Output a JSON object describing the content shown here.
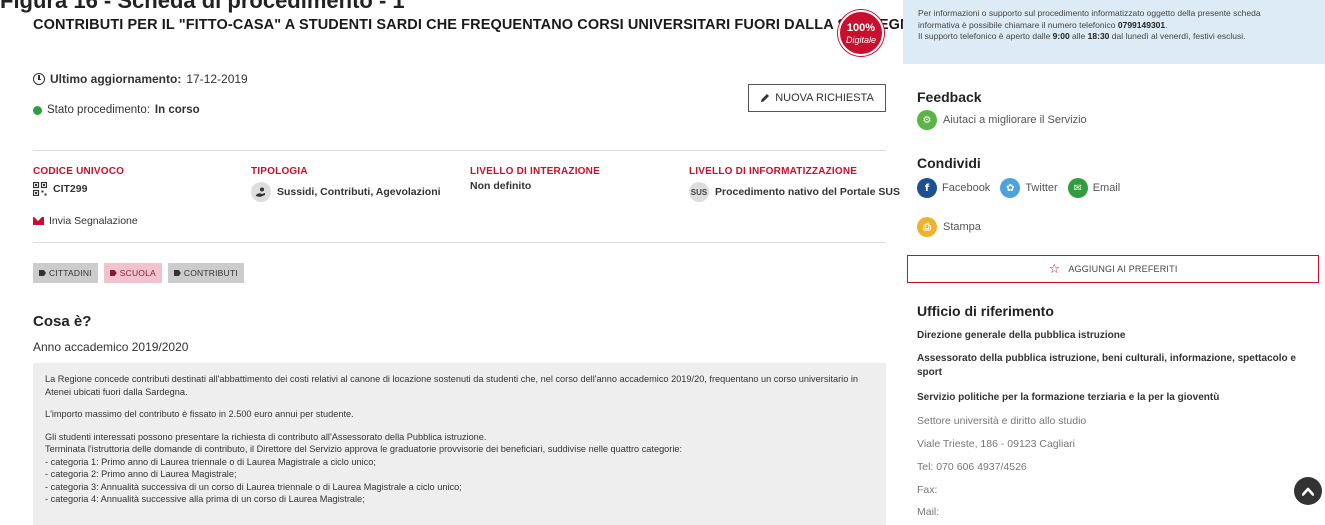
{
  "page_caption": "Figura 16 - Scheda di procedimento - 1",
  "title": "CONTRIBUTI PER IL \"FITTO-CASA\" A STUDENTI SARDI CHE FREQUENTANO CORSI UNIVERSITARI FUORI DALLA SARDEGNA",
  "digital_badge": {
    "percent": "100%",
    "label": "Digitale"
  },
  "updated": {
    "label": "Ultimo aggiornamento:",
    "value": "17-12-2019"
  },
  "status": {
    "label": "Stato procedimento:",
    "value": "In corso"
  },
  "new_request_label": "NUOVA RICHIESTA",
  "meta": {
    "codice": {
      "label": "CODICE UNIVOCO",
      "value": "CIT299"
    },
    "tipologia": {
      "label": "TIPOLOGIA",
      "value": "Sussidi, Contributi, Agevolazioni"
    },
    "livello_interazione": {
      "label": "LIVELLO DI INTERAZIONE",
      "value": "Non definito"
    },
    "livello_informatizzazione": {
      "label": "LIVELLO DI INFORMATIZZAZIONE",
      "badge": "SUS",
      "value": "Procedimento nativo del Portale SUS"
    }
  },
  "report_label": "Invia Segnalazione",
  "tags": [
    "CITTADINI",
    "SCUOLA",
    "CONTRIBUTI"
  ],
  "what_is": {
    "title": "Cosa è?",
    "year": "Anno accademico 2019/2020",
    "p1": "La Regione concede contributi destinati all'abbattimento dei costi relativi al canone di locazione sostenuti da studenti che, nel corso dell'anno accademico 2019/20, frequentano un corso universitario in Atenei ubicati fuori dalla Sardegna.",
    "p2": "L'importo massimo del contributo è fissato in 2.500 euro annui per studente.",
    "p3a": "Gli studenti interessati possono presentare la richiesta di contributo all'Assessorato della Pubblica istruzione.",
    "p3b": "Terminata l'istruttoria delle domande di contributo, il Direttore del Servizio approva le graduatorie provvisorie dei beneficiari, suddivise nelle quattro categorie:",
    "categories": [
      "- categoria 1: Primo anno di Laurea triennale o di Laurea Magistrale a ciclo unico;",
      "- categoria 2: Primo anno di Laurea Magistrale;",
      "- categoria 3: Annualità successiva di un corso di Laurea triennale o di Laurea Magistrale a ciclo unico;",
      "- categoria 4: Annualità successive alla prima di un corso di Laurea Magistrale;"
    ]
  },
  "info_box": {
    "line1": "Per informazioni o supporto sul procedimento informatizzato oggetto della presente scheda",
    "line2_pre": "informativa è possibile chiamare il numero telefonico ",
    "phone": "0799149301",
    "line2_post": ".",
    "line3_pre": "Il supporto telefonico è aperto dalle ",
    "time_from": "9:00",
    "line3_mid": " alle ",
    "time_to": "18:30",
    "line3_post": " dal lunedì al venerdì, festivi esclusi."
  },
  "feedback": {
    "title": "Feedback",
    "link": "Aiutaci a migliorare il Servizio"
  },
  "share": {
    "title": "Condividi",
    "facebook": "Facebook",
    "twitter": "Twitter",
    "email": "Email",
    "print": "Stampa"
  },
  "favorites_label": "AGGIUNGI AI PREFERITI",
  "office": {
    "title": "Ufficio di riferimento",
    "directorate": "Direzione generale della pubblica istruzione",
    "department": "Assessorato della pubblica istruzione, beni culturali, informazione, spettacolo e sport",
    "service": "Servizio politiche per la formazione terziaria e la per la gioventù",
    "sector": "Settore università e diritto allo studio",
    "address": "Viale Trieste, 186 - 09123 Cagliari",
    "tel": "Tel: 070 606 4937/4526",
    "fax": "Fax:",
    "mail": "Mail:"
  }
}
